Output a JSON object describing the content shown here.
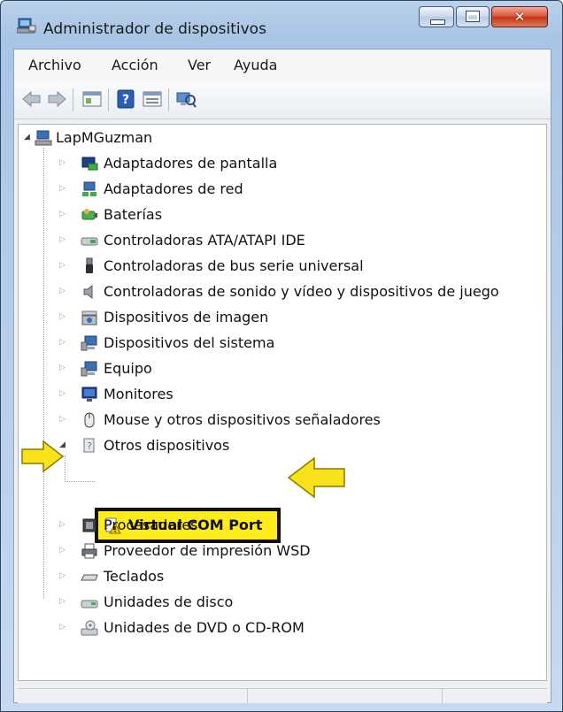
{
  "window": {
    "title": "Administrador de dispositivos",
    "controls": {
      "minimize_icon": "minimize-icon",
      "maximize_icon": "maximize-icon",
      "close_icon": "close-icon"
    }
  },
  "menubar": {
    "items": [
      {
        "label": "Archivo"
      },
      {
        "label": "Acción"
      },
      {
        "label": "Ver"
      },
      {
        "label": "Ayuda"
      }
    ]
  },
  "toolbar": {
    "buttons": [
      {
        "icon": "back-arrow-icon"
      },
      {
        "icon": "forward-arrow-icon"
      },
      {
        "icon": "properties-icon"
      },
      {
        "icon": "help-icon"
      },
      {
        "icon": "details-icon"
      },
      {
        "icon": "scan-hardware-icon"
      }
    ]
  },
  "tree": {
    "root": {
      "label": "LapMGuzman",
      "icon": "computer-icon",
      "expanded": true
    },
    "items": [
      {
        "label": "Adaptadores de pantalla",
        "icon": "display-adapter-icon"
      },
      {
        "label": "Adaptadores de red",
        "icon": "network-adapter-icon"
      },
      {
        "label": "Baterías",
        "icon": "battery-icon"
      },
      {
        "label": "Controladoras ATA/ATAPI IDE",
        "icon": "ide-controller-icon"
      },
      {
        "label": "Controladoras de bus serie universal",
        "icon": "usb-icon"
      },
      {
        "label": "Controladoras de sonido y vídeo y dispositivos de juego",
        "icon": "speaker-icon"
      },
      {
        "label": "Dispositivos de imagen",
        "icon": "camera-icon"
      },
      {
        "label": "Dispositivos del sistema",
        "icon": "system-device-icon"
      },
      {
        "label": "Equipo",
        "icon": "computer-icon"
      },
      {
        "label": "Monitores",
        "icon": "monitor-icon"
      },
      {
        "label": "Mouse y otros dispositivos señaladores",
        "icon": "mouse-icon"
      },
      {
        "label": "Otros dispositivos",
        "icon": "unknown-device-icon",
        "expanded": true,
        "children": [
          {
            "label": "Virtual COM Port",
            "icon": "warning-device-icon"
          }
        ]
      },
      {
        "label": "Procesadores",
        "icon": "processor-icon"
      },
      {
        "label": "Proveedor de impresión WSD",
        "icon": "printer-icon"
      },
      {
        "label": "Teclados",
        "icon": "keyboard-icon"
      },
      {
        "label": "Unidades de disco",
        "icon": "disk-drive-icon"
      },
      {
        "label": "Unidades de DVD o CD-ROM",
        "icon": "dvd-drive-icon"
      }
    ]
  },
  "annotations": {
    "highlight_color": "#fdeb1c",
    "arrow_color": "#f7e21b",
    "arrow_icons": [
      "arrow-right-icon",
      "arrow-left-icon"
    ]
  }
}
